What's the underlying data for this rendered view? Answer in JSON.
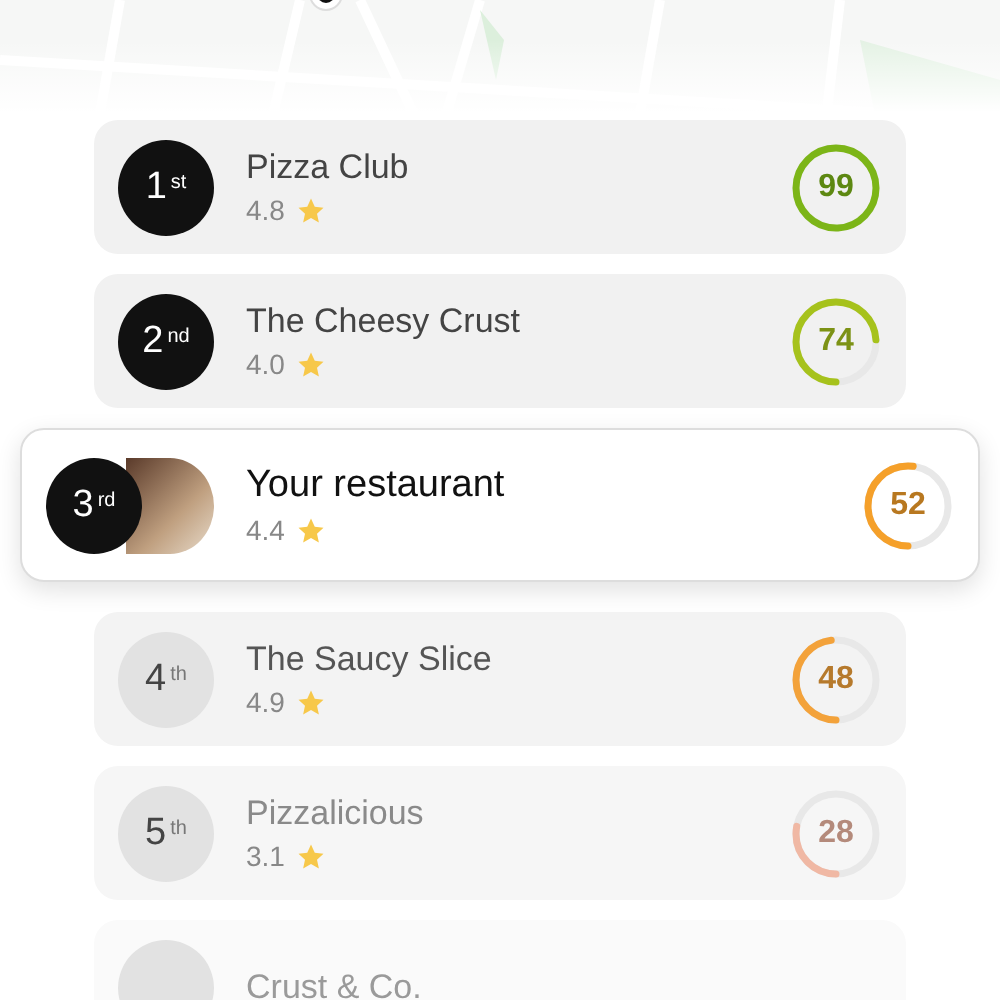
{
  "leaderboard": [
    {
      "kind": "top",
      "rank": "1",
      "suffix": "st",
      "name": "Pizza Club",
      "rating": "4.8",
      "score": "99",
      "level": 0.99,
      "color": "#7cb518"
    },
    {
      "kind": "top",
      "rank": "2",
      "suffix": "nd",
      "name": "The Cheesy Crust",
      "rating": "4.0",
      "score": "74",
      "level": 0.74,
      "color": "#a6c21c"
    },
    {
      "kind": "you",
      "rank": "3",
      "suffix": "rd",
      "name": "Your restaurant",
      "rating": "4.4",
      "score": "52",
      "level": 0.52,
      "color": "#f5a02a"
    },
    {
      "kind": "other",
      "rank": "4",
      "suffix": "th",
      "name": "The Saucy Slice",
      "rating": "4.9",
      "score": "48",
      "level": 0.48,
      "color": "#f3a23a"
    },
    {
      "kind": "other",
      "rank": "5",
      "suffix": "th",
      "name": "Pizzalicious",
      "rating": "3.1",
      "score": "28",
      "level": 0.28,
      "color": "#f0b8a4"
    },
    {
      "kind": "other",
      "name": "Crust & Co."
    }
  ]
}
